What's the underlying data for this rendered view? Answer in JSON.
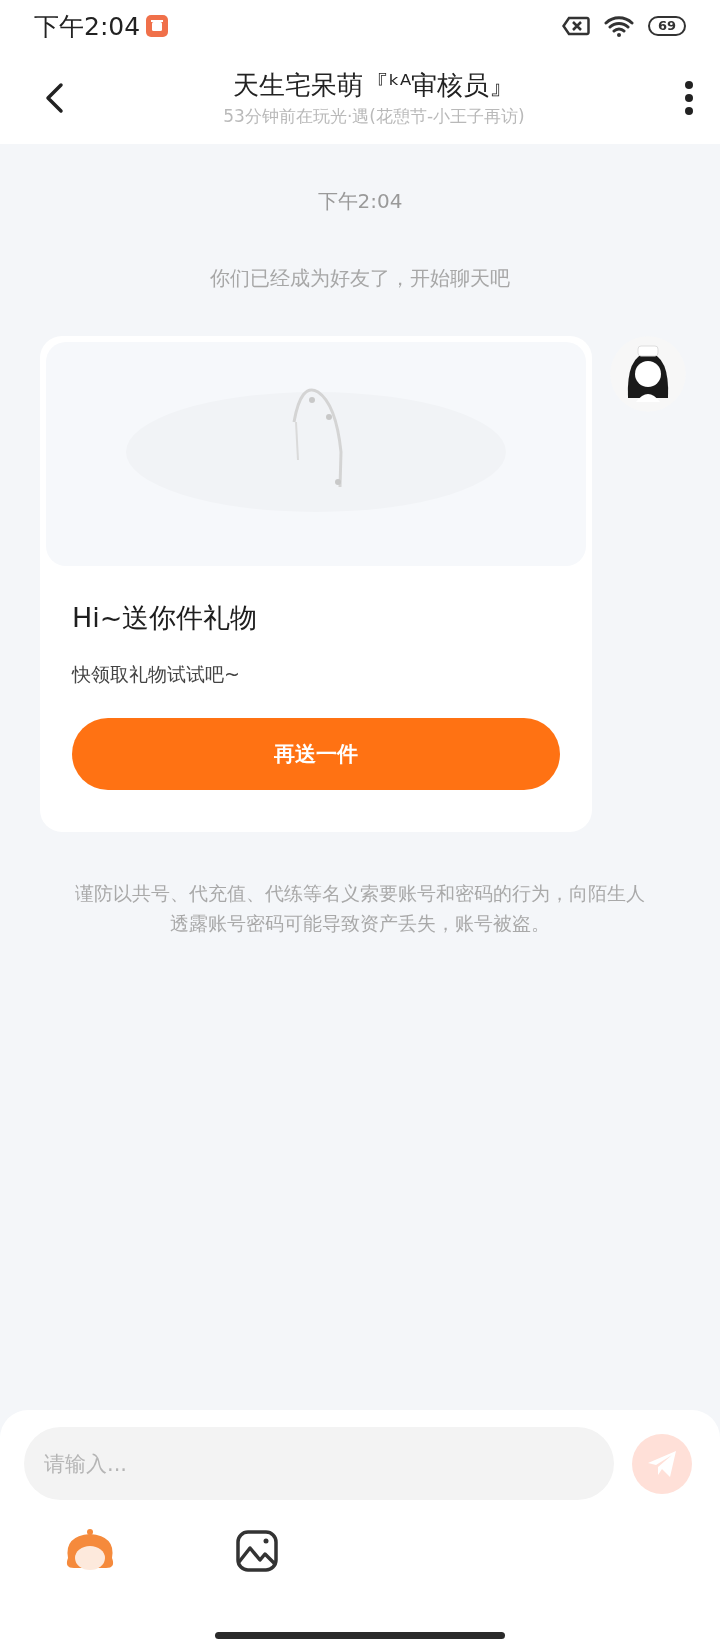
{
  "status_bar": {
    "time": "下午2:04",
    "battery": "69"
  },
  "header": {
    "title": "天生宅呆萌『ᵏᴬ审核员』",
    "subtitle": "53分钟前在玩光·遇(花憩节-小王子再访)"
  },
  "chat": {
    "timestamp": "下午2:04",
    "notice": "你们已经成为好友了，开始聊天吧",
    "gift_card": {
      "title": "Hi~送你件礼物",
      "subtitle": "快领取礼物试试吧~",
      "button": "再送一件"
    },
    "warning": "谨防以共号、代充值、代练等名义索要账号和密码的行为，向陌生人透露账号密码可能导致资产丢失，账号被盗。"
  },
  "composer": {
    "placeholder": "请输入..."
  }
}
